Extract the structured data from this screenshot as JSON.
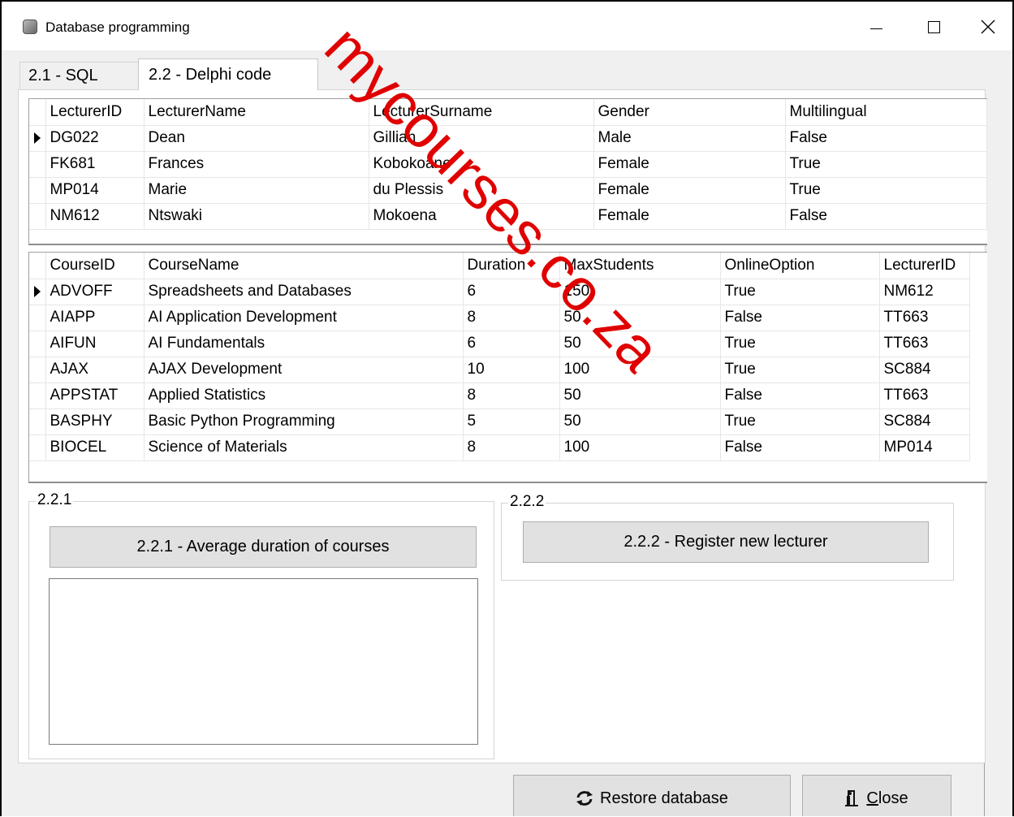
{
  "window": {
    "title": "Database programming"
  },
  "tabs": [
    {
      "label": "2.1 - SQL",
      "active": false
    },
    {
      "label": "2.2 - Delphi code",
      "active": true
    }
  ],
  "lecturers_grid": {
    "columns": [
      "LecturerID",
      "LecturerName",
      "LecturerSurname",
      "Gender",
      "Multilingual"
    ],
    "rows": [
      [
        "DG022",
        "Dean",
        "Gillian",
        "Male",
        "False"
      ],
      [
        "FK681",
        "Frances",
        "Kobokoane",
        "Female",
        "True"
      ],
      [
        "MP014",
        "Marie",
        "du Plessis",
        "Female",
        "True"
      ],
      [
        "NM612",
        "Ntswaki",
        "Mokoena",
        "Female",
        "False"
      ]
    ],
    "current_row": 0
  },
  "courses_grid": {
    "columns": [
      "CourseID",
      "CourseName",
      "Duration",
      "MaxStudents",
      "OnlineOption",
      "LecturerID"
    ],
    "rows": [
      [
        "ADVOFF",
        "Spreadsheets and Databases",
        "6",
        "150",
        "True",
        "NM612"
      ],
      [
        "AIAPP",
        "AI Application Development",
        "8",
        "50",
        "False",
        "TT663"
      ],
      [
        "AIFUN",
        "AI Fundamentals",
        "6",
        "50",
        "True",
        "TT663"
      ],
      [
        "AJAX",
        "AJAX Development",
        "10",
        "100",
        "True",
        "SC884"
      ],
      [
        "APPSTAT",
        "Applied Statistics",
        "8",
        "50",
        "False",
        "TT663"
      ],
      [
        "BASPHY",
        "Basic Python Programming",
        "5",
        "50",
        "True",
        "SC884"
      ],
      [
        "BIOCEL",
        "Science of Materials",
        "8",
        "100",
        "False",
        "MP014"
      ]
    ],
    "current_row": 0
  },
  "group_221": {
    "caption": "2.2.1",
    "button_label": "2.2.1 - Average duration of courses",
    "output_text": ""
  },
  "group_222": {
    "caption": "2.2.2",
    "button_label": "2.2.2 - Register new lecturer"
  },
  "bottom_bar": {
    "restore_label": "Restore database",
    "close_label": "Close"
  },
  "watermark": {
    "text": "mycourses.co.za",
    "color": "#e00000"
  },
  "icons": {
    "app": "app-icon",
    "restore": "refresh-icon",
    "close": "door-exit-icon"
  }
}
